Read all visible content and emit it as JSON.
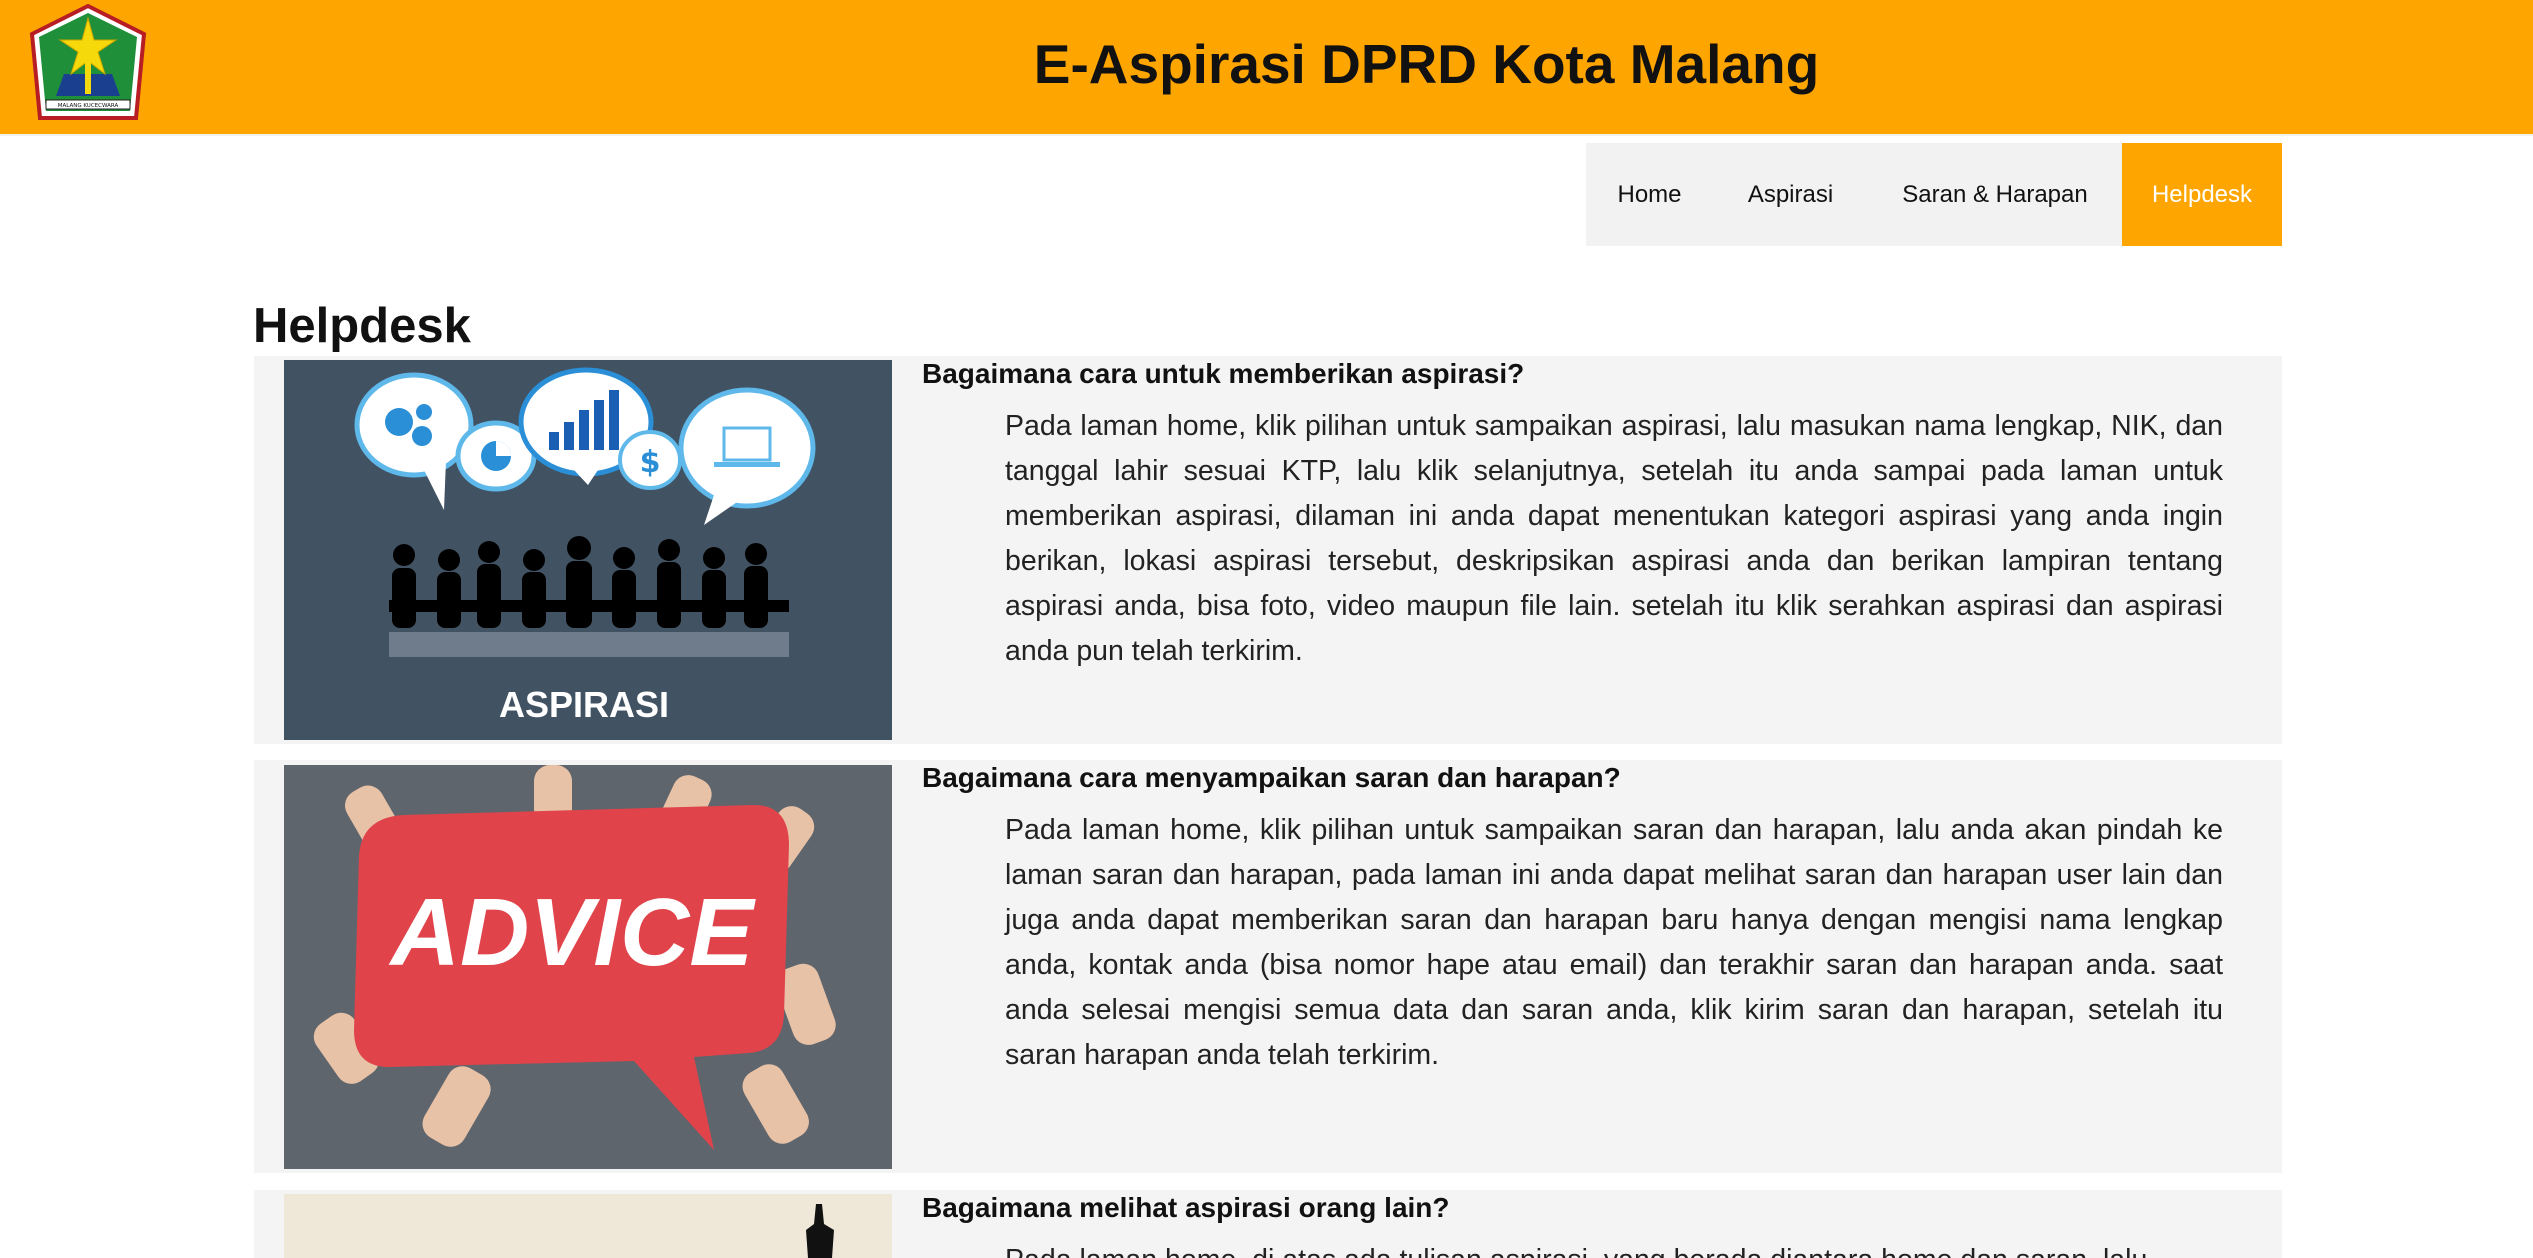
{
  "header": {
    "title": "E-Aspirasi DPRD Kota Malang",
    "logo_icon": "kota-malang-emblem-icon",
    "logo_text": "MALANG KUCECWARA",
    "background_color": "#ffa500"
  },
  "nav": {
    "items": [
      {
        "label": "Home",
        "active": false
      },
      {
        "label": "Aspirasi",
        "active": false
      },
      {
        "label": "Saran & Harapan",
        "active": false
      },
      {
        "label": "Helpdesk",
        "active": true
      }
    ],
    "active_color": "#ffa500"
  },
  "page": {
    "title": "Helpdesk"
  },
  "faq": [
    {
      "question": "Bagaimana cara untuk memberikan aspirasi?",
      "answer": "Pada laman home, klik pilihan untuk sampaikan aspirasi, lalu masukan nama lengkap, NIK, dan tanggal lahir sesuai KTP, lalu klik selanjutnya, setelah itu anda sampai pada laman untuk memberikan aspirasi, dilaman ini anda dapat menentukan kategori aspirasi yang anda ingin berikan, lokasi aspirasi tersebut, deskripsikan aspirasi anda dan berikan lampiran tentang aspirasi anda, bisa foto, video maupun file lain. setelah itu klik serahkan aspirasi dan aspirasi anda pun telah terkirim.",
      "image_caption": "ASPIRASI"
    },
    {
      "question": "Bagaimana cara menyampaikan saran dan harapan?",
      "answer": "Pada laman home, klik pilihan untuk sampaikan saran dan harapan, lalu anda akan pindah ke laman saran dan harapan, pada laman ini anda dapat melihat saran dan harapan user lain dan juga anda dapat memberikan saran dan harapan baru hanya dengan mengisi nama lengkap anda, kontak anda (bisa nomor hape atau email) dan terakhir saran dan harapan anda. saat anda selesai mengisi semua data dan saran anda, klik kirim saran dan harapan, setelah itu saran harapan anda telah terkirim.",
      "image_caption": "ADVICE"
    },
    {
      "question": "Bagaimana melihat aspirasi orang lain?",
      "answer": "Pada laman home, di atas ada tulisan aspirasi, yang berada diantara home dan saran, lalu"
    }
  ]
}
